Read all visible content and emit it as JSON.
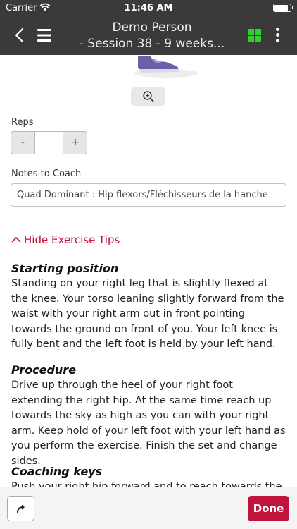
{
  "status_bar": {
    "carrier": "Carrier",
    "time": "11:46 AM"
  },
  "nav": {
    "title_line1": "Demo Person",
    "title_line2": "- Session 38 - 9 weeks..."
  },
  "reps": {
    "label": "Reps",
    "minus_label": "-",
    "plus_label": "+",
    "value": ""
  },
  "notes": {
    "label": "Notes to Coach",
    "value": "Quad Dominant : Hip flexors/Fléchisseurs de la hanche"
  },
  "tips_toggle_label": "Hide Exercise Tips",
  "tips": [
    {
      "heading": "Starting position",
      "body": "Standing on your right leg that is slightly flexed at the knee. Your torso leaning slightly forward from the waist with your right arm out in front pointing towards the ground on front of you. Your left knee is fully bent and the left foot is held by your left hand."
    },
    {
      "heading": "Procedure",
      "body": "Drive up through the heel of your right foot extending the right hip. At the same time reach up towards the sky as high as you can with your right arm. Keep hold of your left foot with your left hand as you perform the exercise. Finish the set and change sides."
    },
    {
      "heading": "Coaching keys",
      "body": "Push your right hip forward and to reach towards the sky"
    }
  ],
  "bottom": {
    "done_label": "Done"
  },
  "colors": {
    "accent": "#c0143c",
    "nav_bg": "#3a3a3a",
    "grid_icon": "#2fd12f"
  },
  "icons": [
    "wifi-icon",
    "battery-icon",
    "back-icon",
    "menu-icon",
    "grid-icon",
    "more-icon",
    "zoom-icon",
    "chevron-up-icon",
    "redo-icon"
  ]
}
